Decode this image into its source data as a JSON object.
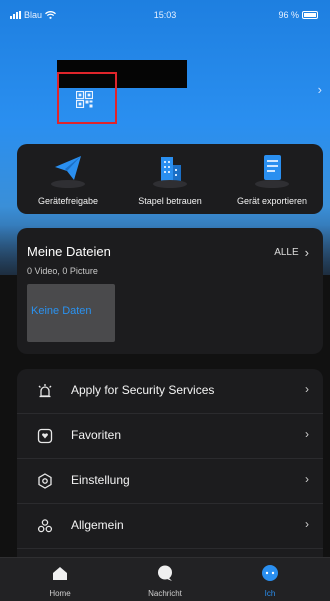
{
  "status_bar": {
    "carrier": "Blau",
    "time": "15:03",
    "battery": "96 %"
  },
  "profile": {
    "qr_icon": "qr-code-icon",
    "chevron": "›"
  },
  "actions": [
    {
      "label": "Gerätefreigabe",
      "icon": "paper-plane-icon"
    },
    {
      "label": "Stapel betrauen",
      "icon": "building-icon"
    },
    {
      "label": "Gerät exportieren",
      "icon": "document-export-icon"
    }
  ],
  "files": {
    "title": "Meine Dateien",
    "all_label": "ALLE",
    "all_chevron": "›",
    "counts": "0 Video,  0 Picture",
    "empty_label": "Keine Daten"
  },
  "menu": [
    {
      "label": "Apply for Security Services",
      "icon": "alarm-icon",
      "chevron": "›"
    },
    {
      "label": "Favoriten",
      "icon": "favorite-icon",
      "chevron": "›"
    },
    {
      "label": "Einstellung",
      "icon": "settings-icon",
      "chevron": "›"
    },
    {
      "label": "Allgemein",
      "icon": "general-icon",
      "chevron": "›"
    }
  ],
  "tabs": [
    {
      "label": "Home",
      "icon": "home-icon"
    },
    {
      "label": "Nachricht",
      "icon": "message-icon"
    },
    {
      "label": "Ich",
      "icon": "profile-icon",
      "active": true
    }
  ],
  "colors": {
    "accent": "#2a8ff0",
    "highlight": "#e0252b",
    "card": "#1c1c1e",
    "background": "#111111"
  }
}
